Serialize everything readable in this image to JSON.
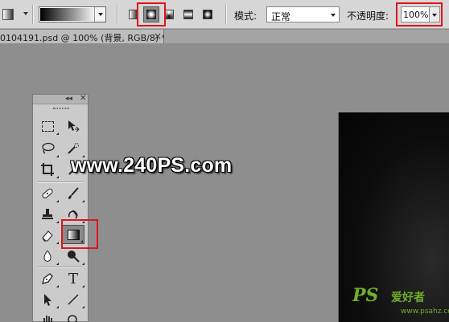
{
  "options_bar": {
    "gradient_types": [
      "linear",
      "radial",
      "angle",
      "reflected",
      "diamond"
    ],
    "selected_gradient_type": "radial",
    "mode_label": "模式:",
    "mode_value": "正常",
    "opacity_label": "不透明度:",
    "opacity_value": "100%"
  },
  "document": {
    "tab_label": "0104191.psd @ 100% (背景, RGB/8) *",
    "close_glyph": "×"
  },
  "tools_panel": {
    "collapse_glyph": "◂◂",
    "close_glyph": "✕",
    "tools": {
      "type_label": "T"
    }
  },
  "watermark": {
    "site": "www.240PS.com",
    "logo_text": "PS",
    "logo_cn": "爱好者",
    "logo_url": "www.psahz.com"
  },
  "colors": {
    "highlight": "#e0141b",
    "logo_green": "#6fae2c"
  }
}
